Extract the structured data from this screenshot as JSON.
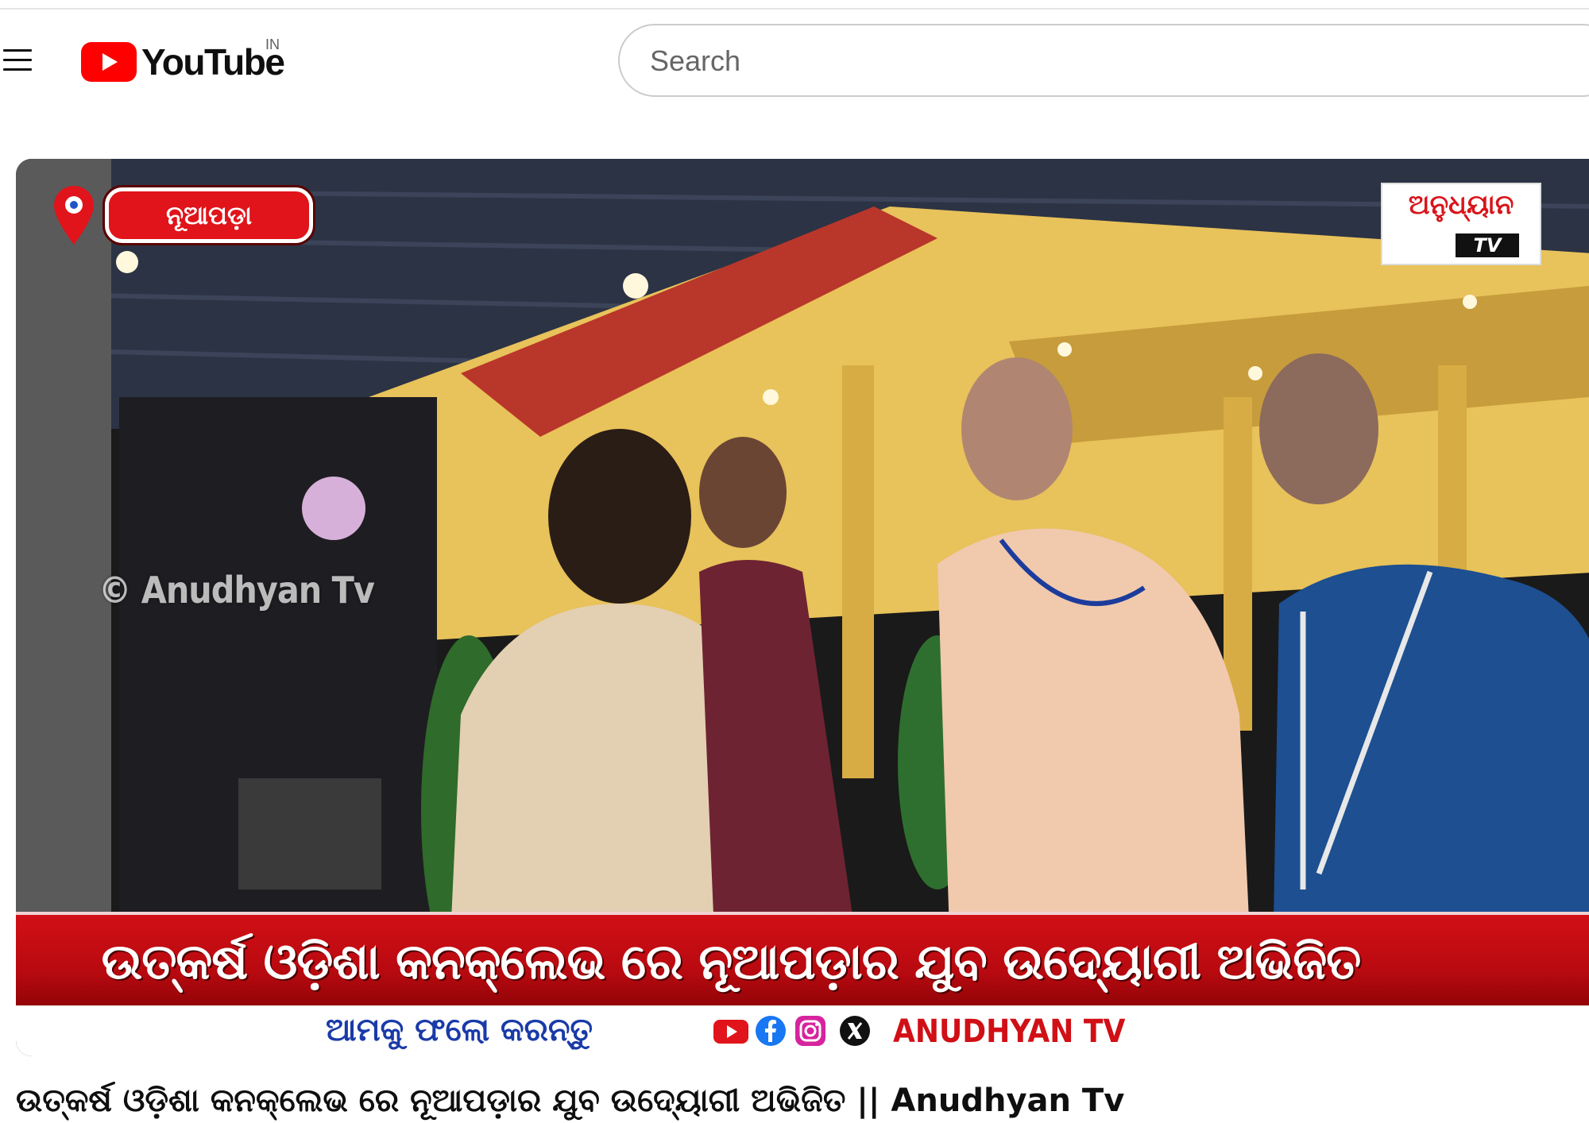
{
  "masthead": {
    "menu_icon": "hamburger-menu-icon",
    "logo_text": "YouTube",
    "country_code": "IN",
    "search_placeholder": "Search",
    "brand_color": "#ff0000"
  },
  "video": {
    "location_tag": "ନୂଆପଡ଼ା",
    "channel_logo_text": "ଅନୁଧ୍ୟାନ",
    "channel_logo_tv": "TV",
    "watermark": "© Anudhyan Tv",
    "headline": "ଉତ୍କର୍ଷ ଓଡ଼ିଶା କନକ୍ଲେଭ ରେ ନୂଆପଡ଼ାର ଯୁବ ଉଦ୍ୟୋଗୀ ଅଭିଜିତ",
    "follow_text": "ଆମକୁ ଫଲୋ କରନ୍ତୁ",
    "social_icons": [
      "youtube-icon",
      "facebook-icon",
      "instagram-icon",
      "x-icon"
    ],
    "brand_handle": "ANUDHYAN TV",
    "accent_red": "#d10f16",
    "follow_blue": "#1a3aa8"
  },
  "title": "ଉତ୍କର୍ଷ ଓଡ଼ିଶା କନକ୍ଲେଭ ରେ ନୂଆପଡ଼ାର ଯୁବ ଉଦ୍ୟୋଗୀ ଅଭିଜିତ || Anudhyan Tv"
}
